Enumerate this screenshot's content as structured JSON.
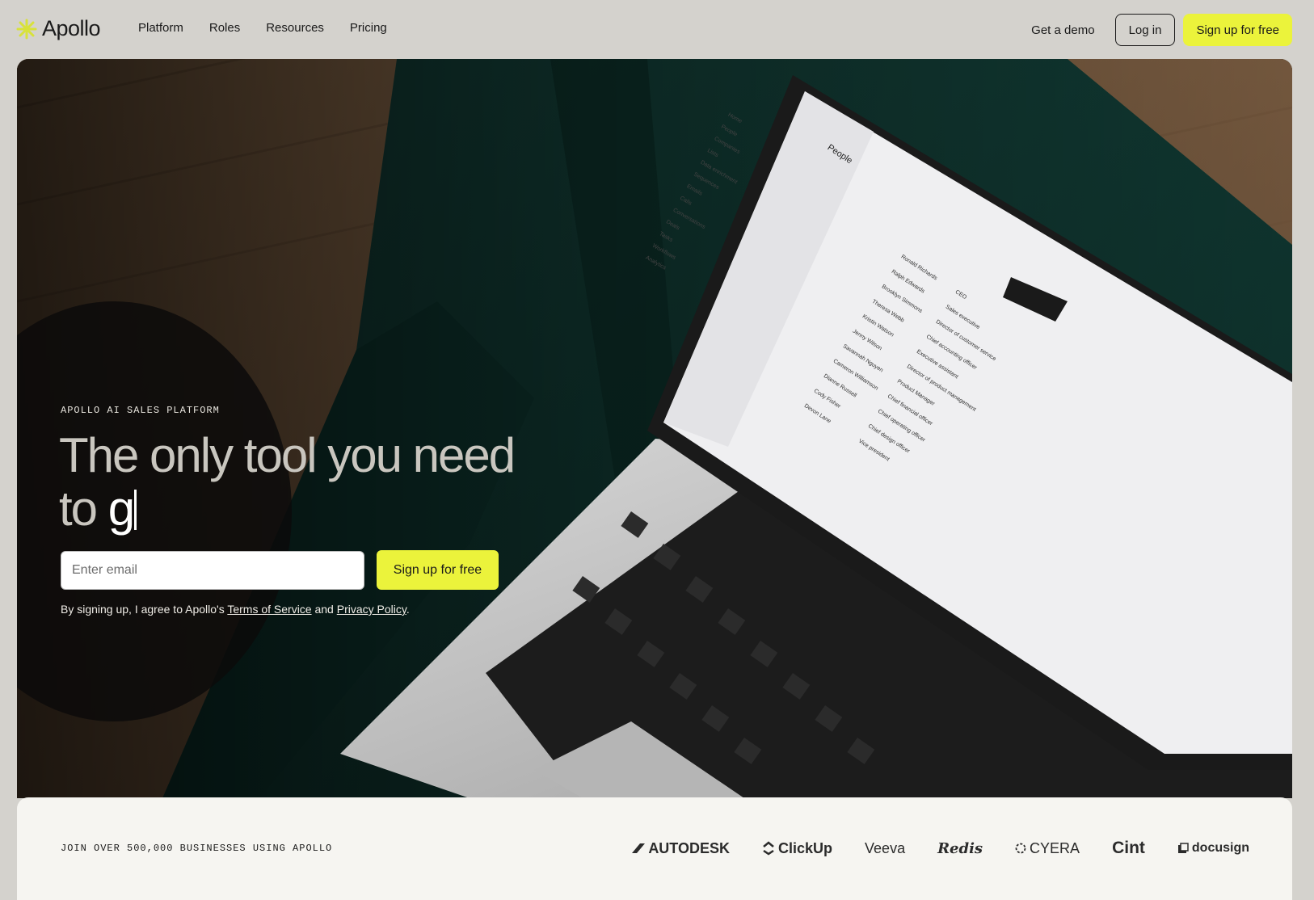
{
  "nav": {
    "logo_text": "Apollo",
    "links": [
      "Platform",
      "Roles",
      "Resources",
      "Pricing"
    ],
    "demo_label": "Get a demo",
    "login_label": "Log in",
    "signup_label": "Sign up for free"
  },
  "hero": {
    "eyebrow": "APOLLO AI SALES PLATFORM",
    "headline_static": "The only tool you need to ",
    "headline_typed": "g",
    "email_placeholder": "Enter email",
    "signup_label": "Sign up for free",
    "legal_prefix": "By signing up, I agree to Apollo's ",
    "terms_label": "Terms of Service",
    "legal_and": " and ",
    "privacy_label": "Privacy Policy",
    "legal_suffix": "."
  },
  "laptop_screen": {
    "page_title": "People",
    "sidebar": [
      "Home",
      "People",
      "Companies",
      "Lists",
      "Data enrichment",
      "Sequences",
      "Emails",
      "Calls",
      "Conversations",
      "Deals",
      "Tasks",
      "Workflows",
      "Analytics"
    ],
    "names": [
      "Ronald Richards",
      "Ralph Edwards",
      "Brooklyn Simmons",
      "Theresa Webb",
      "Kristin Watson",
      "Jenny Wilson",
      "Savannah Nguyen",
      "Cameron Williamson",
      "Dianne Russell",
      "Cody Fisher",
      "Devon Lane"
    ],
    "titles": [
      "CEO",
      "Sales executive",
      "Director of customer service",
      "Chief accounting officer",
      "Executive assistant",
      "Director of product management",
      "Product Manager",
      "Chief financial officer",
      "Chief operating officer",
      "Chief design officer",
      "Vice president"
    ]
  },
  "strip": {
    "label": "JOIN OVER 500,000 BUSINESSES USING APOLLO",
    "brands": [
      "AUTODESK",
      "ClickUp",
      "Veeva",
      "Redis",
      "CYERA",
      "Cint",
      "docusign"
    ]
  },
  "colors": {
    "accent_yellow": "#ebf33b",
    "page_bg": "#d4d2cd",
    "strip_bg": "#f6f5f1",
    "sofa_green": "#0f3a34"
  }
}
